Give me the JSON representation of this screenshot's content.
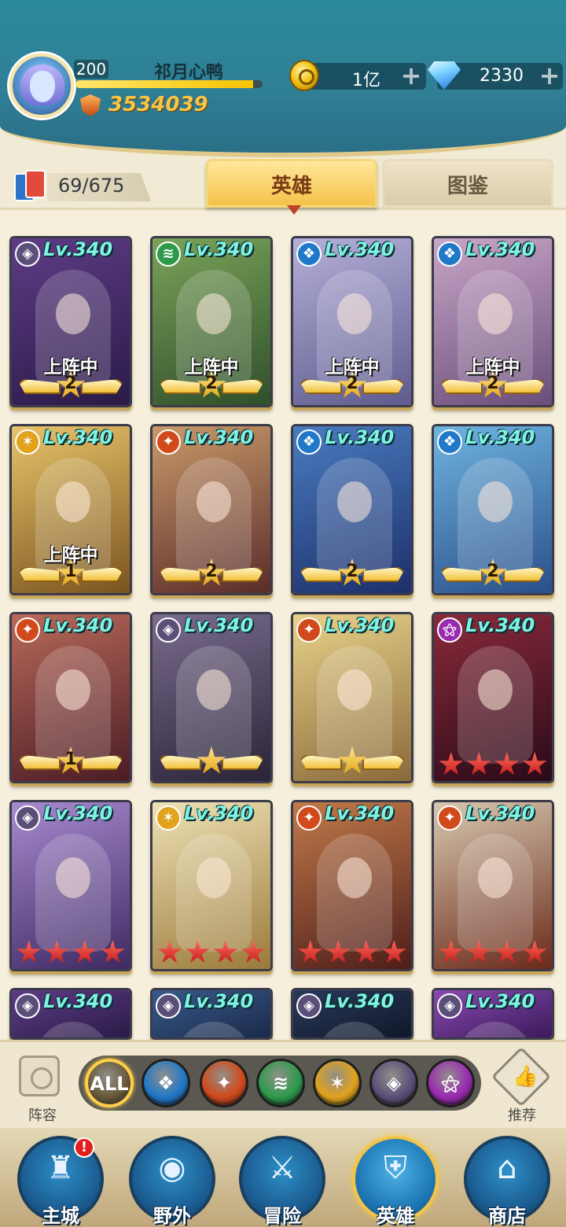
{
  "player": {
    "level": "200",
    "name": "祁月心鸭",
    "xp_fraction": 0.95,
    "power": "3534039"
  },
  "currency": {
    "gold": "1亿",
    "gems": "2330",
    "plus": "+"
  },
  "collection": {
    "count": "69/675"
  },
  "tabs": [
    {
      "label": "英雄",
      "active": true
    },
    {
      "label": "图鉴",
      "active": false
    }
  ],
  "hero_status_label": "上阵中",
  "heroes": [
    {
      "element": "dark",
      "level": "Lv.340",
      "in_team": true,
      "rank_type": "wings",
      "rank": "2",
      "palette": [
        "#5e3c86",
        "#2a1b47"
      ]
    },
    {
      "element": "wind",
      "level": "Lv.340",
      "in_team": true,
      "rank_type": "wings",
      "rank": "2",
      "palette": [
        "#7aa35a",
        "#2f4f2a"
      ]
    },
    {
      "element": "water",
      "level": "Lv.340",
      "in_team": true,
      "rank_type": "wings",
      "rank": "2",
      "palette": [
        "#b4b0d8",
        "#5f5b8e"
      ]
    },
    {
      "element": "water",
      "level": "Lv.340",
      "in_team": true,
      "rank_type": "wings",
      "rank": "2",
      "palette": [
        "#c9a6c8",
        "#6a4e7a"
      ]
    },
    {
      "element": "light",
      "level": "Lv.340",
      "in_team": true,
      "rank_type": "wings",
      "rank": "1",
      "palette": [
        "#e7c46a",
        "#7a5420"
      ]
    },
    {
      "element": "fire",
      "level": "Lv.340",
      "in_team": false,
      "rank_type": "wings",
      "rank": "2",
      "palette": [
        "#c99a6a",
        "#5a2c2a"
      ]
    },
    {
      "element": "water",
      "level": "Lv.340",
      "in_team": false,
      "rank_type": "wings",
      "rank": "2",
      "palette": [
        "#4a7cc0",
        "#1d2f6a"
      ]
    },
    {
      "element": "water",
      "level": "Lv.340",
      "in_team": false,
      "rank_type": "wings",
      "rank": "2",
      "palette": [
        "#6fb4e0",
        "#2a4f8a"
      ]
    },
    {
      "element": "fire",
      "level": "Lv.340",
      "in_team": false,
      "rank_type": "wings",
      "rank": "1",
      "palette": [
        "#b96a5a",
        "#4a1c24"
      ]
    },
    {
      "element": "dark",
      "level": "Lv.340",
      "in_team": false,
      "rank_type": "wings-star",
      "rank": "",
      "palette": [
        "#7a6c8e",
        "#2a2438"
      ]
    },
    {
      "element": "fire",
      "level": "Lv.340",
      "in_team": false,
      "rank_type": "wings-star",
      "rank": "",
      "palette": [
        "#e8d28a",
        "#8a6a3a"
      ]
    },
    {
      "element": "arcane",
      "level": "Lv.340",
      "in_team": false,
      "rank_type": "red-stars",
      "rank": "4",
      "palette": [
        "#8a2a3a",
        "#2a0a18"
      ]
    },
    {
      "element": "dark",
      "level": "Lv.340",
      "in_team": false,
      "rank_type": "red-stars",
      "rank": "4",
      "palette": [
        "#a88ad0",
        "#3e2a62"
      ]
    },
    {
      "element": "light",
      "level": "Lv.340",
      "in_team": false,
      "rank_type": "red-stars",
      "rank": "4",
      "palette": [
        "#efe2b6",
        "#9a7a3a"
      ]
    },
    {
      "element": "fire",
      "level": "Lv.340",
      "in_team": false,
      "rank_type": "red-stars",
      "rank": "4",
      "palette": [
        "#c27a4a",
        "#4e1e1a"
      ]
    },
    {
      "element": "fire",
      "level": "Lv.340",
      "in_team": false,
      "rank_type": "red-stars",
      "rank": "4",
      "palette": [
        "#d8c8b0",
        "#6a2a1a"
      ]
    },
    {
      "element": "dark",
      "level": "Lv.340",
      "in_team": false,
      "rank_type": "none",
      "rank": "",
      "palette": [
        "#5e3c86",
        "#2a1b47"
      ]
    },
    {
      "element": "dark",
      "level": "Lv.340",
      "in_team": false,
      "rank_type": "none",
      "rank": "",
      "palette": [
        "#3a5a8a",
        "#1a2a4a"
      ]
    },
    {
      "element": "dark",
      "level": "Lv.340",
      "in_team": false,
      "rank_type": "none",
      "rank": "",
      "palette": [
        "#2a3a5a",
        "#10182a"
      ]
    },
    {
      "element": "dark",
      "level": "Lv.340",
      "in_team": false,
      "rank_type": "none",
      "rank": "",
      "palette": [
        "#8a4ab0",
        "#3a1a5a"
      ]
    }
  ],
  "element_colors": {
    "dark": "#5b4f7a",
    "wind": "#2d9a4a",
    "water": "#1f78c8",
    "fire": "#d24a1c",
    "light": "#e1a21c",
    "arcane": "#9a2ab0"
  },
  "element_glyphs": {
    "dark": "◈",
    "wind": "≋",
    "water": "❖",
    "fire": "✦",
    "light": "✶",
    "arcane": "⚝"
  },
  "filters": {
    "lineup_label": "阵容",
    "recommend_label": "推荐",
    "options": [
      {
        "id": "all",
        "label": "ALL",
        "color": "#6a5a3a",
        "active": true
      },
      {
        "id": "water",
        "label": "",
        "color": "#1f78c8",
        "active": false
      },
      {
        "id": "fire",
        "label": "",
        "color": "#d24a1c",
        "active": false
      },
      {
        "id": "wind",
        "label": "",
        "color": "#2d9a4a",
        "active": false
      },
      {
        "id": "light",
        "label": "",
        "color": "#e1a21c",
        "active": false
      },
      {
        "id": "dark",
        "label": "",
        "color": "#5b4f7a",
        "active": false
      },
      {
        "id": "arcane",
        "label": "",
        "color": "#9a2ab0",
        "active": false
      }
    ]
  },
  "nav": {
    "items": [
      {
        "id": "main-city",
        "label": "主城",
        "glyph": "♜",
        "active": false,
        "badge": "!"
      },
      {
        "id": "wild",
        "label": "野外",
        "glyph": "◉",
        "active": false,
        "badge": ""
      },
      {
        "id": "adventure",
        "label": "冒险",
        "glyph": "⚔",
        "active": false,
        "badge": ""
      },
      {
        "id": "heroes",
        "label": "英雄",
        "glyph": "⛨",
        "active": true,
        "badge": ""
      },
      {
        "id": "shop",
        "label": "商店",
        "glyph": "⌂",
        "active": false,
        "badge": ""
      }
    ]
  }
}
